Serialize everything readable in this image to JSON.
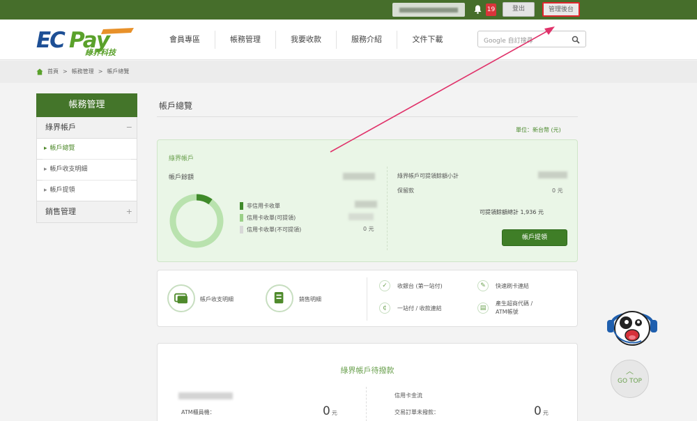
{
  "topbar": {
    "notification_count": "19",
    "logout_label": "登出",
    "admin_label": "管理後台"
  },
  "brand": {
    "name": "ECPay",
    "subtitle": "綠界科技"
  },
  "nav": [
    "會員專區",
    "帳務管理",
    "我要收款",
    "服務介紹",
    "文件下載"
  ],
  "search": {
    "placeholder": "Google 自訂搜尋"
  },
  "breadcrumb": {
    "home": "首頁",
    "sep": ">",
    "level2": "帳務管理",
    "current": "帳戶總覽"
  },
  "sidebar": {
    "title": "帳務管理",
    "group1": {
      "label": "綠界帳戶",
      "toggle": "−"
    },
    "items": [
      {
        "label": "帳戶總覽"
      },
      {
        "label": "帳戶收支明細"
      },
      {
        "label": "帳戶提領"
      }
    ],
    "group2": {
      "label": "銷售管理",
      "toggle": "+"
    }
  },
  "page_title": "帳戶總覽",
  "unit_text": "單位：新台幣 (元)",
  "account_card": {
    "title": "綠界帳戶",
    "balance_label": "帳戶餘額",
    "ring_fill": 0.1,
    "legend": [
      {
        "label": "非信用卡收單",
        "color": "#3f8a2a"
      },
      {
        "label": "信用卡收單(可提領)",
        "color": "#9ad088"
      },
      {
        "label": "信用卡收單(不可提領)",
        "color": "#d8d8d8"
      }
    ],
    "legend_value3": "0 元",
    "right_label1": "綠界帳戶可提領餘額小計",
    "right_label2": "保留款",
    "right_value2": "0 元",
    "total_text": "可提領餘額總計 1,936 元",
    "withdraw_button": "帳戶提領"
  },
  "quick_links": {
    "left": [
      {
        "label": "帳戶收支明細",
        "icon": "ledger-icon"
      },
      {
        "label": "銷售明細",
        "icon": "receipt-icon"
      }
    ],
    "right": [
      {
        "label": "收銀台 (第一站付)",
        "icon": "cart-icon"
      },
      {
        "label": "快速刷卡連結",
        "icon": "card-link-icon"
      },
      {
        "label": "一站付 / 收款連結",
        "icon": "pay-link-icon"
      },
      {
        "label1": "產生超商代碼 /",
        "label2": "ATM帳號",
        "icon": "code-icon"
      }
    ]
  },
  "pending_card": {
    "title": "綠界帳戶待撥款",
    "left_label": "ATM櫃員機：",
    "left_value": "0",
    "left_unit": "元",
    "right_heading": "信用卡金流",
    "right_label": "交易訂單未撥款：",
    "right_value": "0",
    "right_unit": "元"
  },
  "gotop_label": "GO TOP",
  "colors": {
    "brand_green": "#466e2b",
    "accent_red": "#e0262d",
    "card_green": "#eaf6e7"
  }
}
